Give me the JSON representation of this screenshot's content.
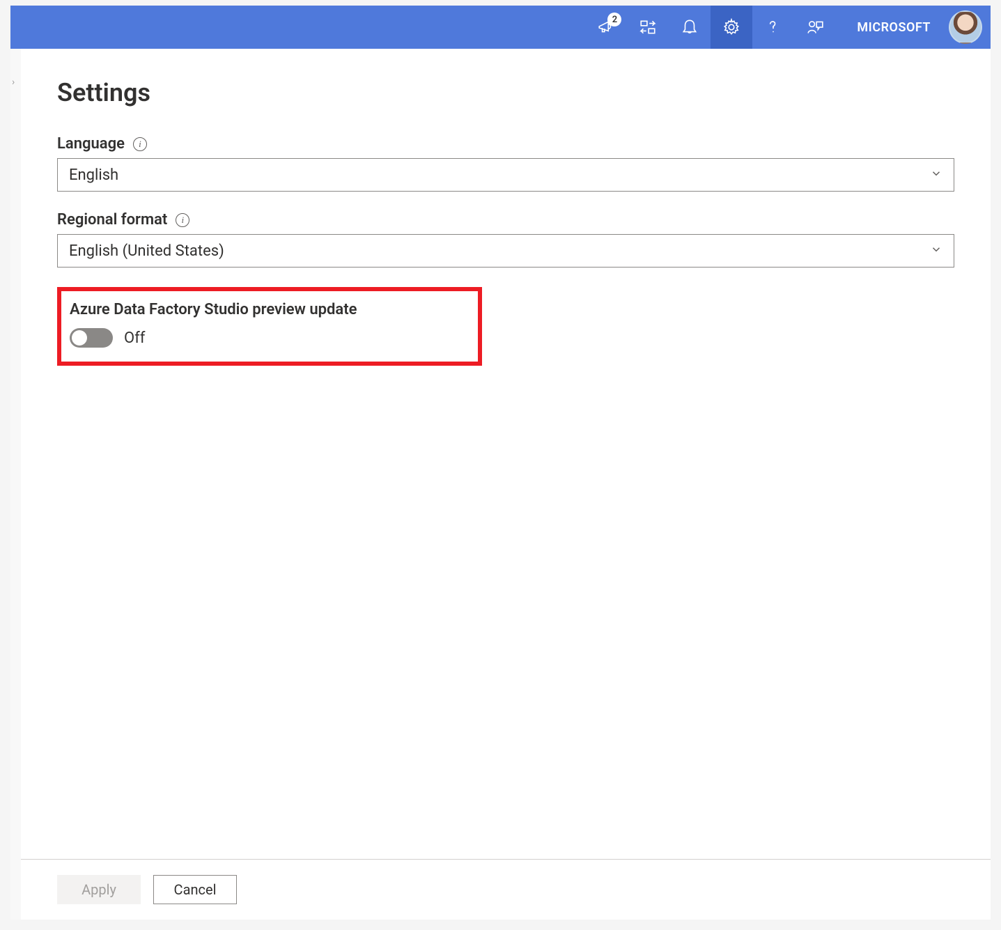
{
  "header": {
    "tenant_label": "MICROSOFT",
    "announcements_badge": "2"
  },
  "settings": {
    "page_title": "Settings",
    "language": {
      "label": "Language",
      "value": "English"
    },
    "regional_format": {
      "label": "Regional format",
      "value": "English (United States)"
    },
    "preview_update": {
      "label": "Azure Data Factory Studio preview update",
      "state_text": "Off"
    }
  },
  "footer": {
    "apply_label": "Apply",
    "cancel_label": "Cancel"
  }
}
